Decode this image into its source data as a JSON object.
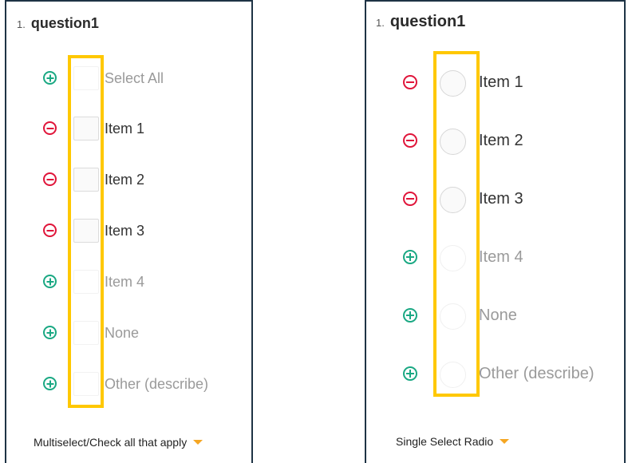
{
  "panels": [
    {
      "question_number": "1.",
      "question_title": "question1",
      "input_type": "checkbox",
      "options": [
        {
          "label": "Select All",
          "action": "add",
          "state": "muted"
        },
        {
          "label": "Item 1",
          "action": "remove",
          "state": "active"
        },
        {
          "label": "Item 2",
          "action": "remove",
          "state": "active"
        },
        {
          "label": "Item 3",
          "action": "remove",
          "state": "active"
        },
        {
          "label": "Item 4",
          "action": "add",
          "state": "muted"
        },
        {
          "label": "None",
          "action": "add",
          "state": "muted"
        },
        {
          "label": "Other (describe)",
          "action": "add",
          "state": "muted"
        }
      ],
      "question_type_label": "Multiselect/Check all that apply"
    },
    {
      "question_number": "1.",
      "question_title": "question1",
      "input_type": "radio",
      "options": [
        {
          "label": "Item 1",
          "action": "remove",
          "state": "active"
        },
        {
          "label": "Item 2",
          "action": "remove",
          "state": "active"
        },
        {
          "label": "Item 3",
          "action": "remove",
          "state": "active"
        },
        {
          "label": "Item 4",
          "action": "add",
          "state": "muted"
        },
        {
          "label": "None",
          "action": "add",
          "state": "muted"
        },
        {
          "label": "Other (describe)",
          "action": "add",
          "state": "muted"
        }
      ],
      "question_type_label": "Single Select Radio"
    }
  ],
  "colors": {
    "panel_border": "#1e3345",
    "add_icon": "#1aa883",
    "remove_icon": "#e0153a",
    "highlight_box": "#ffc800",
    "dropdown_caret": "#f5a623",
    "active_text": "#333333",
    "muted_text": "#9a9a9a"
  },
  "icons": {
    "add": "plus-circle-icon",
    "remove": "minus-circle-icon",
    "dropdown": "caret-down-icon"
  }
}
